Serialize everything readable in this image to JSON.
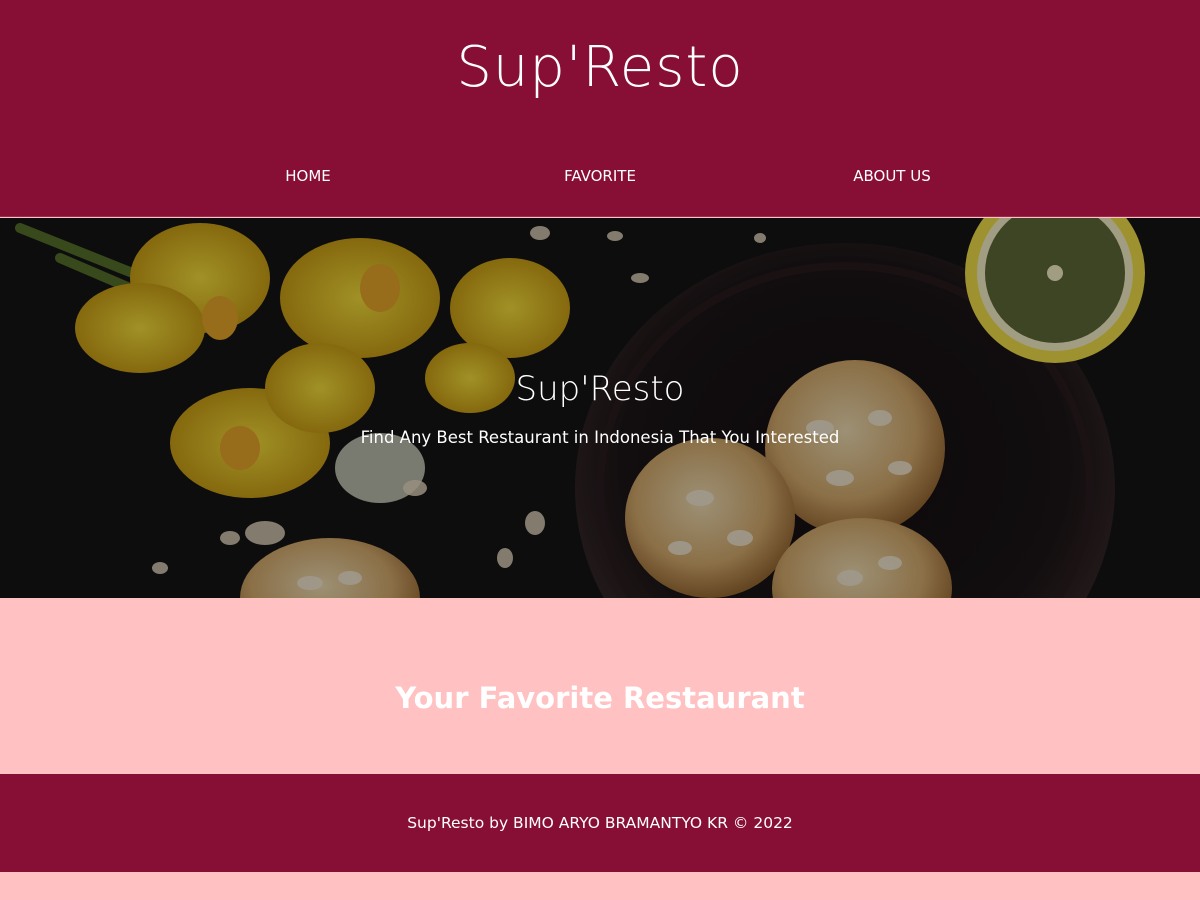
{
  "header": {
    "brand": "Sup'Resto",
    "nav": [
      {
        "label": "HOME"
      },
      {
        "label": "FAVORITE"
      },
      {
        "label": "ABOUT US"
      }
    ]
  },
  "hero": {
    "title": "Sup'Resto",
    "tagline": "Find Any Best Restaurant in Indonesia That You Interested",
    "image": "hero-food-photo"
  },
  "favorite": {
    "title": "Your Favorite Restaurant"
  },
  "footer": {
    "text": "Sup'Resto by BIMO ARYO BRAMANTYO KR © 2022"
  },
  "colors": {
    "primary": "#870e35",
    "secondary": "#ffc1c1",
    "text_light": "#ffffff"
  }
}
